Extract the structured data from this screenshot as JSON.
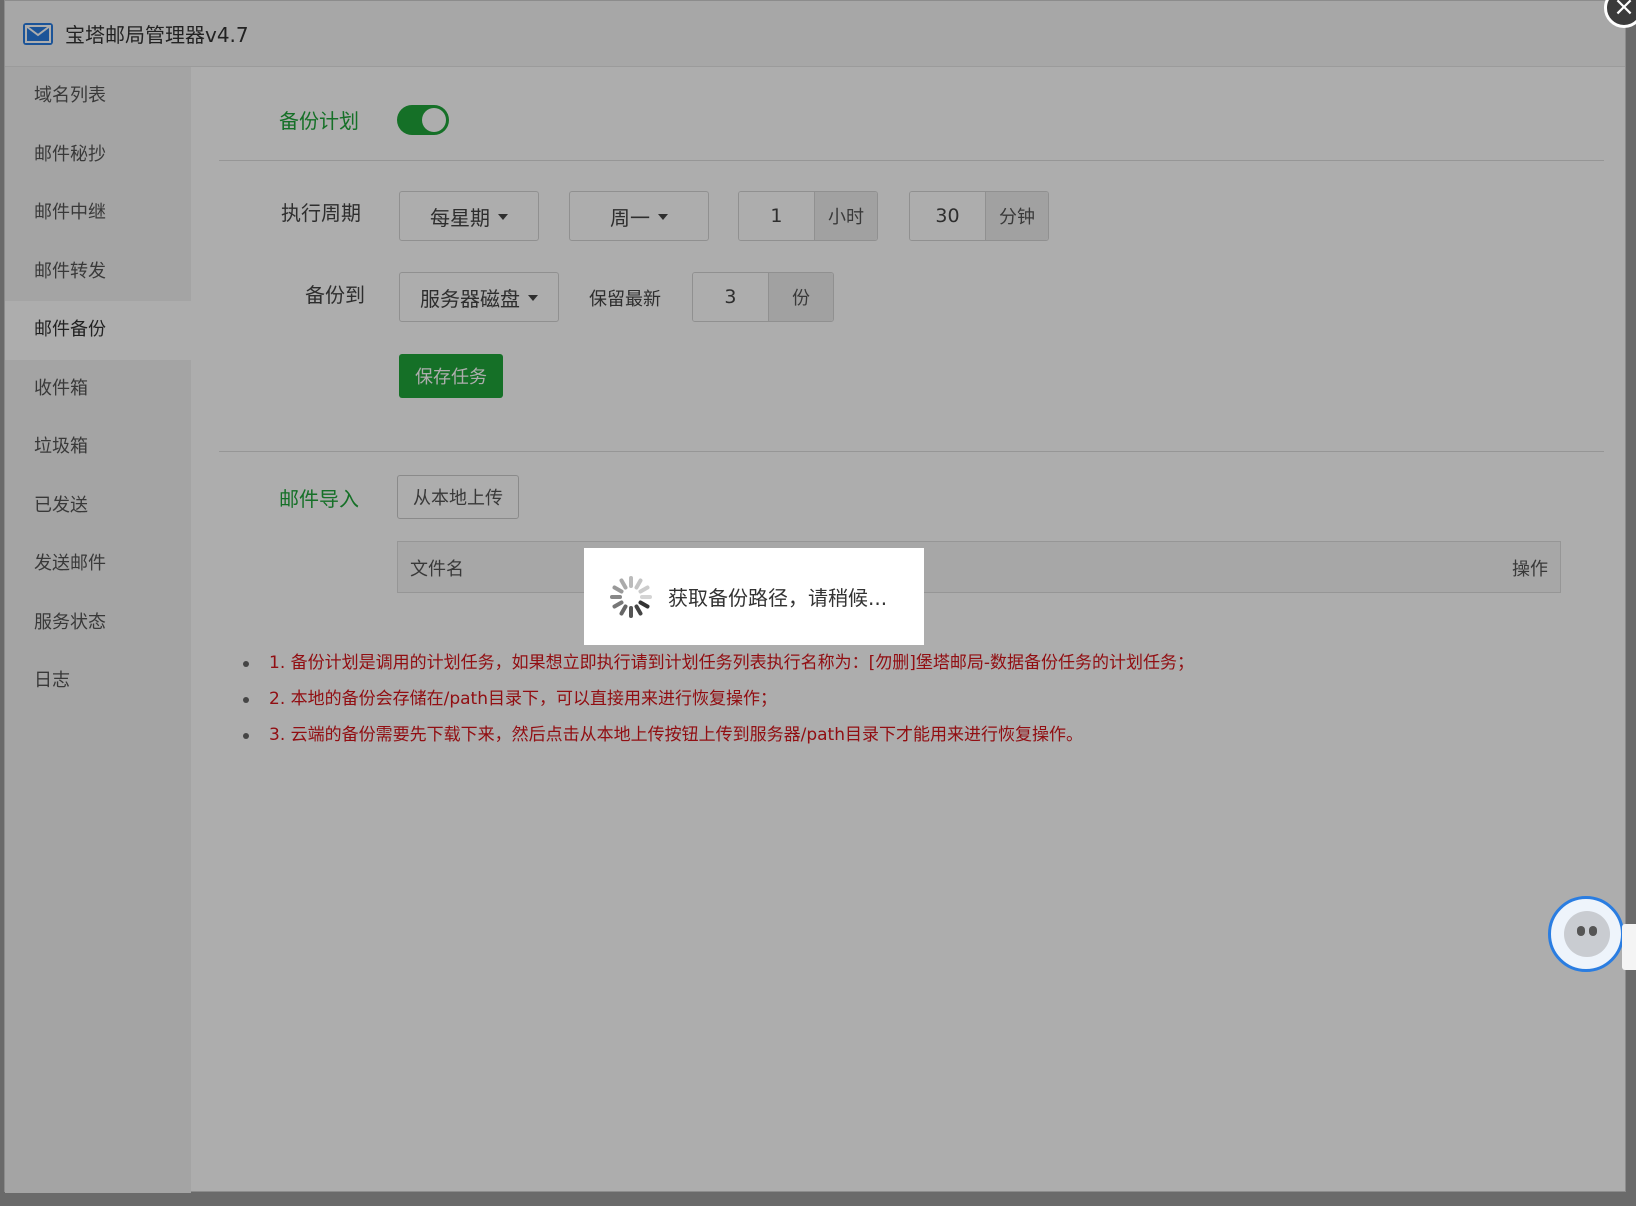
{
  "window": {
    "title": "宝塔邮局管理器v4.7",
    "close_icon": "close-icon"
  },
  "sidebar": {
    "items": [
      {
        "label": "域名列表"
      },
      {
        "label": "邮件秘抄"
      },
      {
        "label": "邮件中继"
      },
      {
        "label": "邮件转发"
      },
      {
        "label": "邮件备份",
        "active": true
      },
      {
        "label": "收件箱"
      },
      {
        "label": "垃圾箱"
      },
      {
        "label": "已发送"
      },
      {
        "label": "发送邮件"
      },
      {
        "label": "服务状态"
      },
      {
        "label": "日志"
      }
    ]
  },
  "backup_plan": {
    "label": "备份计划",
    "enabled": true,
    "period_label": "执行周期",
    "period_value": "每星期",
    "weekday_value": "周一",
    "hour_value": "1",
    "hour_unit": "小时",
    "minute_value": "30",
    "minute_unit": "分钟",
    "target_label": "备份到",
    "target_value": "服务器磁盘",
    "keep_label": "保留最新",
    "keep_value": "3",
    "keep_unit": "份",
    "save_button": "保存任务"
  },
  "mail_import": {
    "label": "邮件导入",
    "upload_button": "从本地上传",
    "table_headers": [
      "文件名",
      "操作"
    ]
  },
  "notes": [
    "1. 备份计划是调用的计划任务，如果想立即执行请到计划任务列表执行名称为：[勿删]堡塔邮局-数据备份任务的计划任务；",
    "2. 本地的备份会存储在/path目录下，可以直接用来进行恢复操作；",
    "3. 云端的备份需要先下载下来，然后点击从本地上传按钮上传到服务器/path目录下才能用来进行恢复操作。"
  ],
  "loading": {
    "text": "获取备份路径，请稍候..."
  },
  "colors": {
    "accent": "#20a53a",
    "warning_text": "#d6161b",
    "brand_blue": "#2a7de1"
  }
}
